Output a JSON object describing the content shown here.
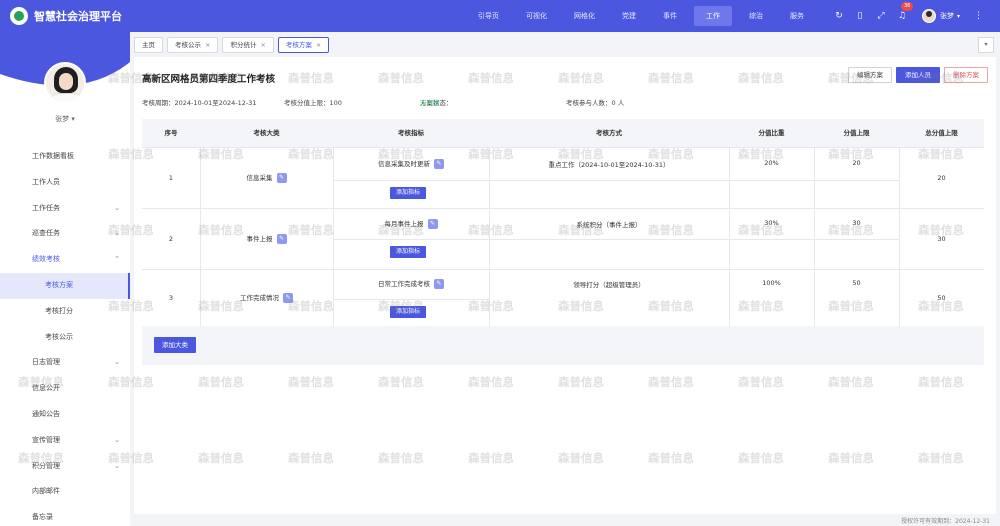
{
  "app": {
    "title": "智慧社会治理平台"
  },
  "nav": [
    "引导页",
    "可视化",
    "网格化",
    "党建",
    "事件",
    "工作",
    "综治",
    "服务"
  ],
  "nav_active_index": 5,
  "notifications": {
    "count": "36"
  },
  "user": {
    "name": "张梦"
  },
  "sidebar": {
    "profile_name": "张梦",
    "items": [
      {
        "label": "工作数据看板"
      },
      {
        "label": "工作人员"
      },
      {
        "label": "工作任务"
      },
      {
        "label": "巡查任务"
      },
      {
        "label": "绩效考核"
      },
      {
        "label": "考核方案"
      },
      {
        "label": "考核打分"
      },
      {
        "label": "考核公示"
      },
      {
        "label": "日志管理"
      },
      {
        "label": "信息公开"
      },
      {
        "label": "通知公告"
      },
      {
        "label": "宣传管理"
      },
      {
        "label": "积分管理"
      },
      {
        "label": "内部邮件"
      },
      {
        "label": "备忘录"
      }
    ]
  },
  "tabs": [
    {
      "label": "主页"
    },
    {
      "label": "考核公示"
    },
    {
      "label": "积分统计"
    },
    {
      "label": "考核方案"
    }
  ],
  "page": {
    "title": "高新区网格员第四季度工作考核",
    "actions": {
      "edit": "编辑方案",
      "add_person": "添加人员",
      "delete": "删除方案"
    },
    "info": {
      "period": "考核周期：2024-10-01至2024-12-31",
      "max_score_label": "考核分值上限：100",
      "status_label": "方案状态：",
      "status_value": "未开始",
      "participants": "考核参与人数：0 人"
    },
    "table": {
      "headers": [
        "序号",
        "考核大类",
        "考核指标",
        "考核方式",
        "分值比重",
        "分值上限",
        "总分值上限"
      ],
      "rows": [
        {
          "no": "1",
          "category": "信息采集",
          "indicator": "信息采集及时更新",
          "method": "重点工作（2024-10-01至2024-10-31）",
          "weight": "20%",
          "cap": "20",
          "total": "20"
        },
        {
          "no": "2",
          "category": "事件上报",
          "indicator": "每月事件上报",
          "method": "系统积分（事件上报）",
          "weight": "30%",
          "cap": "30",
          "total": "30"
        },
        {
          "no": "3",
          "category": "工作完成情况",
          "indicator": "日常工作完成考核",
          "method": "领导打分（超级管理员）",
          "weight": "100%",
          "cap": "50",
          "total": "50"
        }
      ],
      "add_indicator": "添加指标",
      "add_category": "添加大类"
    }
  },
  "watermark_text": "森普信息",
  "footer": "授权许可有效期到：2024-12-31"
}
